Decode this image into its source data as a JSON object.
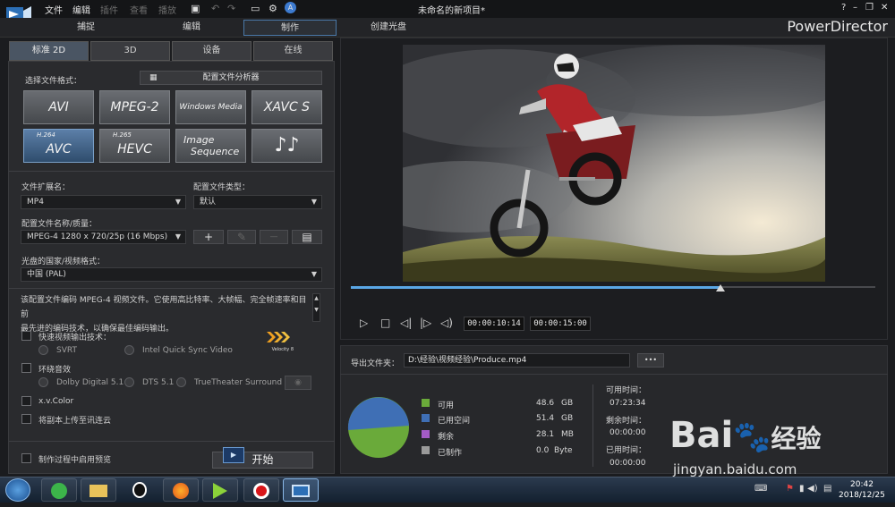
{
  "menu": {
    "file": "文件",
    "edit": "编辑",
    "plugins": "插件",
    "view": "查看",
    "play": "播放"
  },
  "window_title": "未命名的新项目*",
  "window_controls": {
    "help": "?",
    "minimize": "–",
    "restore": "❐",
    "close": "✕"
  },
  "modes": {
    "capture": "捕捉",
    "edit": "编辑",
    "produce": "制作",
    "create_disc": "创建光盘"
  },
  "brand": "PowerDirector",
  "tabs": [
    "标准 2D",
    "3D",
    "设备",
    "在线"
  ],
  "format": {
    "label": "选择文件格式：",
    "analyzer_button": "配置文件分析器",
    "buttons": {
      "avi": "AVI",
      "mpeg2": "MPEG-2",
      "wmv": "Windows Media",
      "xavc": "XAVC S",
      "avc_sup": "H.264",
      "avc": "AVC",
      "hevc_sup": "H.265",
      "hevc": "HEVC",
      "img1": "Image",
      "img2": "Sequence",
      "audio": "♪♪"
    }
  },
  "file_ext": {
    "label": "文件扩展名：",
    "value": "MP4"
  },
  "profile_type": {
    "label": "配置文件类型：",
    "value": "默认"
  },
  "profile_quality": {
    "label": "配置文件名称/质量：",
    "value": "MPEG-4 1280 x 720/25p (16 Mbps)",
    "add": "+",
    "remove": "—"
  },
  "region": {
    "label": "光盘的国家/视频格式：",
    "value": "中国 (PAL)"
  },
  "description": {
    "line1": "该配置文件编码 MPEG-4 视频文件。它使用高比特率、大帧幅、完全帧速率和目前",
    "line2": "最先进的编码技术，以确保最佳编码输出。"
  },
  "options": {
    "fast_render": "快速视频输出技术：",
    "svrt": "SVRT",
    "intel": "Intel Quick Sync Video",
    "velocity": "Velocity 8",
    "surround": "环绕音效",
    "dolby": "Dolby Digital 5.1",
    "dts": "DTS 5.1",
    "truetheater": "TrueTheater Surround",
    "xvcolor": "x.v.Color",
    "upload": "将副本上传至讯连云",
    "preview": "制作过程中启用预览",
    "start": "开始"
  },
  "timecodes": {
    "current": "00:00:10:14",
    "total": "00:00:15:00"
  },
  "playback": {
    "progress": 0.705
  },
  "output": {
    "label": "导出文件夹：",
    "path": "D:\\经验\\视频经验\\Produce.mp4",
    "browse": "•••"
  },
  "disk": {
    "items": [
      {
        "name": "可用",
        "value": "48.6",
        "unit": "GB",
        "color": "#6aaa3a"
      },
      {
        "name": "已用空间",
        "value": "51.4",
        "unit": "GB",
        "color": "#3f6fb5"
      },
      {
        "name": "剩余",
        "value": "28.1",
        "unit": "MB",
        "color": "#a45bc5"
      },
      {
        "name": "已制作",
        "value": "0.0",
        "unit": "Byte",
        "color": "#9a9a9a"
      }
    ]
  },
  "time": {
    "avail_label": "可用时间：",
    "avail": "07:23:34",
    "remain_label": "剩余时间：",
    "remain": "00:00:00",
    "used_label": "已用时间：",
    "used": "00:00:00"
  },
  "taskbar": {
    "time": "20:42",
    "date": "2018/12/25"
  },
  "watermark": {
    "brand": "Bai",
    "brand2": "经验",
    "url": "jingyan.baidu.com"
  },
  "colors": {
    "accent": "#5aa7e6",
    "selected_format": "#3f6390"
  }
}
